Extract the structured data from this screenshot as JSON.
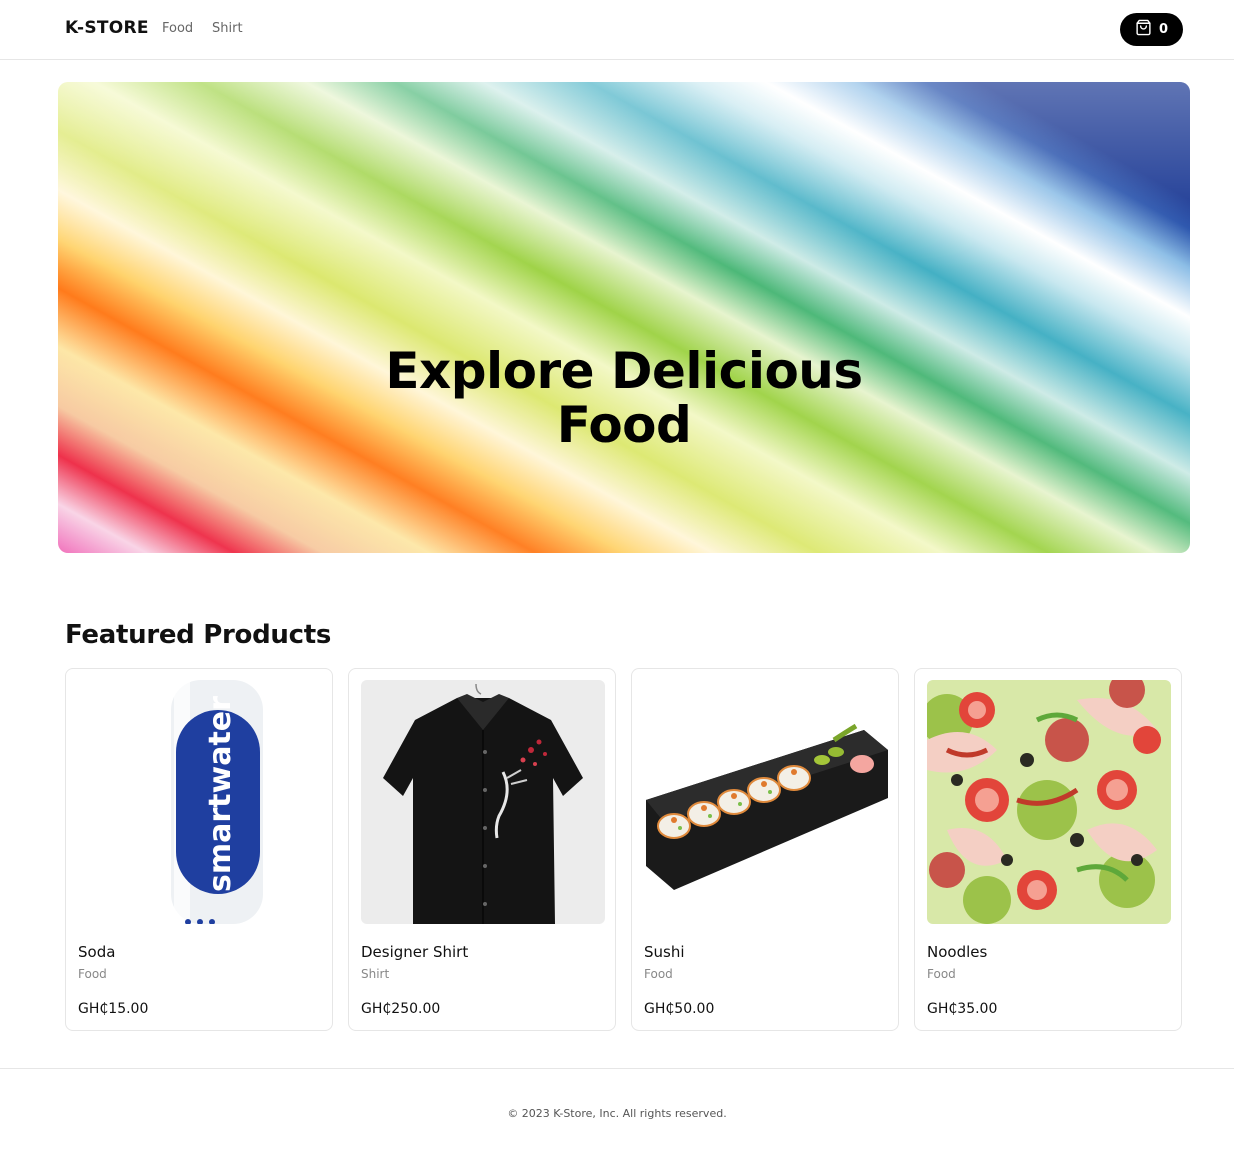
{
  "header": {
    "logo": "K-STORE",
    "nav": [
      {
        "label": "Food"
      },
      {
        "label": "Shirt"
      }
    ],
    "cart": {
      "icon": "shopping-bag-icon",
      "count": "0"
    }
  },
  "hero": {
    "title_line1": "Explore Delicious",
    "title_line2": "Food"
  },
  "featured": {
    "title": "Featured Products",
    "products": [
      {
        "name": "Soda",
        "category": "Food",
        "price": "GH₵15.00",
        "image": "water-bottle-image",
        "image_text": "smartwater"
      },
      {
        "name": "Designer Shirt",
        "category": "Shirt",
        "price": "GH₵250.00",
        "image": "black-shirt-image"
      },
      {
        "name": "Sushi",
        "category": "Food",
        "price": "GH₵50.00",
        "image": "sushi-platter-image"
      },
      {
        "name": "Noodles",
        "category": "Food",
        "price": "GH₵35.00",
        "image": "salad-image"
      }
    ]
  },
  "footer": {
    "text": "© 2023 K-Store, Inc. All rights reserved."
  }
}
